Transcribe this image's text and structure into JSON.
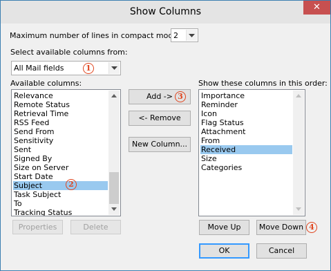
{
  "dialog": {
    "title": "Show Columns",
    "close_glyph": "✕"
  },
  "compact": {
    "label": "Maximum number of lines in compact mode:",
    "value": "2"
  },
  "select_from": {
    "label": "Select available columns from:",
    "value": "All Mail fields"
  },
  "available": {
    "label": "Available columns:",
    "items": [
      "Relevance",
      "Remote Status",
      "Retrieval Time",
      "RSS Feed",
      "Send From",
      "Sensitivity",
      "Sent",
      "Signed By",
      "Size on Server",
      "Start Date",
      "Subject",
      "Task Subject",
      "To",
      "Tracking Status"
    ],
    "selected": "Subject"
  },
  "shown": {
    "label": "Show these columns in this order:",
    "items": [
      "Importance",
      "Reminder",
      "Icon",
      "Flag Status",
      "Attachment",
      "From",
      "Received",
      "Size",
      "Categories"
    ],
    "selected": "Received"
  },
  "buttons": {
    "add": "Add ->",
    "remove": "<- Remove",
    "new_column": "New Column...",
    "properties": "Properties",
    "delete": "Delete",
    "move_up": "Move Up",
    "move_down": "Move Down",
    "ok": "OK",
    "cancel": "Cancel"
  },
  "markers": {
    "m1": "1",
    "m2": "2",
    "m3": "3",
    "m4": "4"
  },
  "colors": {
    "selection": "#99c9ef",
    "marker": "#e0451e",
    "close": "#c75050"
  }
}
